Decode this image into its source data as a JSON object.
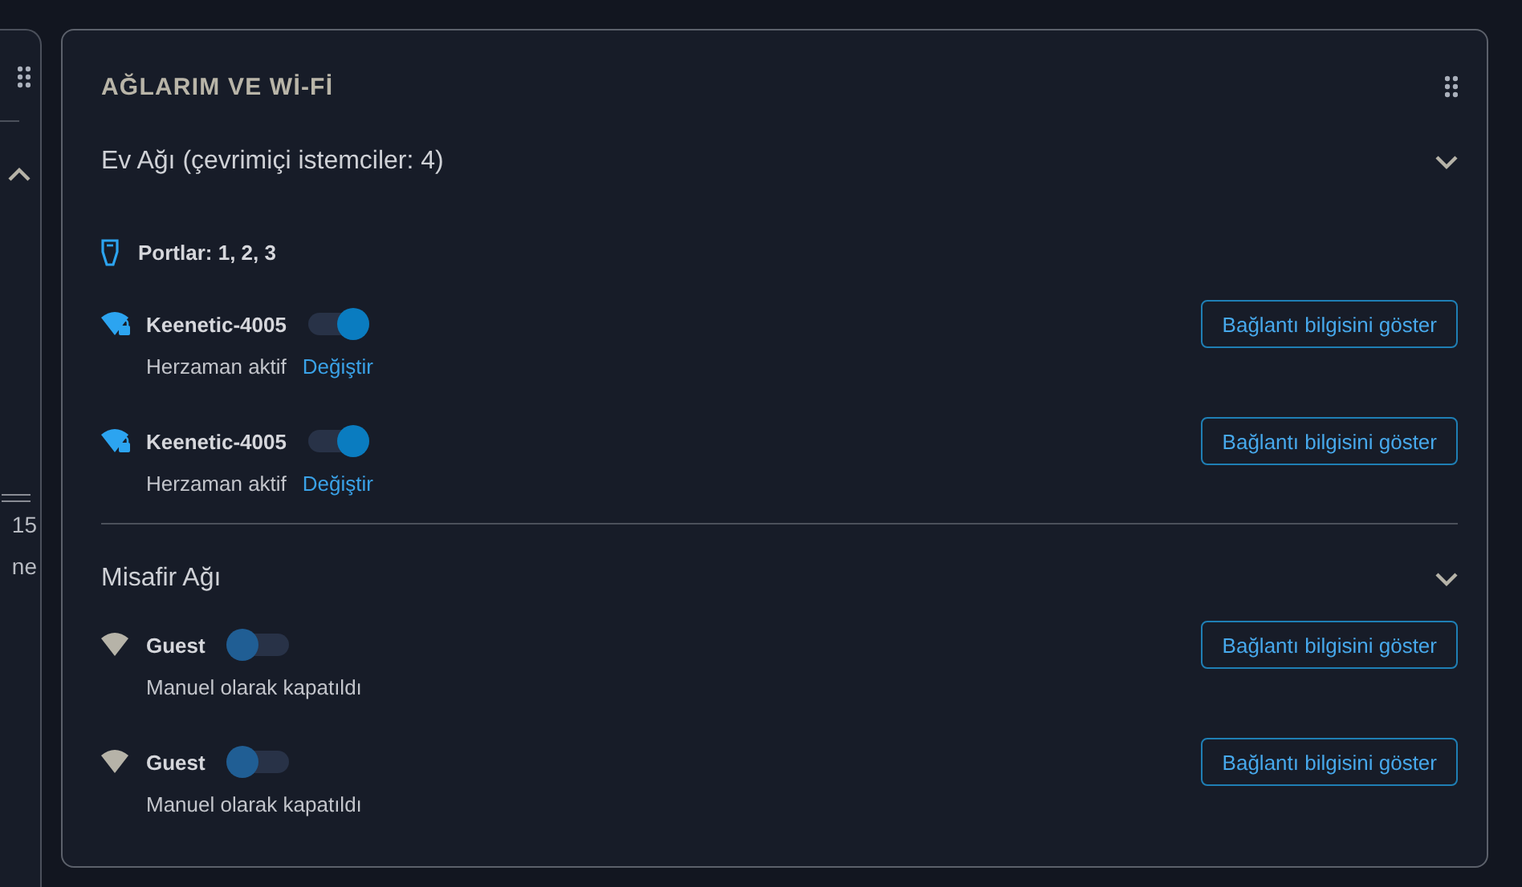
{
  "side_panel": {
    "expanded": true,
    "texts": [
      "15",
      "ne"
    ]
  },
  "card": {
    "title": "AĞLARIM VE Wİ-Fİ",
    "sections": [
      {
        "title": "Ev Ağı (çevrimiçi istemciler: 4)",
        "ports": "Portlar: 1, 2, 3",
        "networks": [
          {
            "name": "Keenetic-4005",
            "on": true,
            "secured": true,
            "status": "Herzaman aktif",
            "link": "Değiştir",
            "button": "Bağlantı bilgisini göster"
          },
          {
            "name": "Keenetic-4005",
            "on": true,
            "secured": true,
            "status": "Herzaman aktif",
            "link": "Değiştir",
            "button": "Bağlantı bilgisini göster"
          }
        ]
      },
      {
        "title": "Misafir Ağı",
        "networks": [
          {
            "name": "Guest",
            "on": false,
            "secured": false,
            "status": "Manuel olarak kapatıldı",
            "button": "Bağlantı bilgisini göster"
          },
          {
            "name": "Guest",
            "on": false,
            "secured": false,
            "status": "Manuel olarak kapatıldı",
            "button": "Bağlantı bilgisini göster"
          }
        ]
      }
    ]
  }
}
